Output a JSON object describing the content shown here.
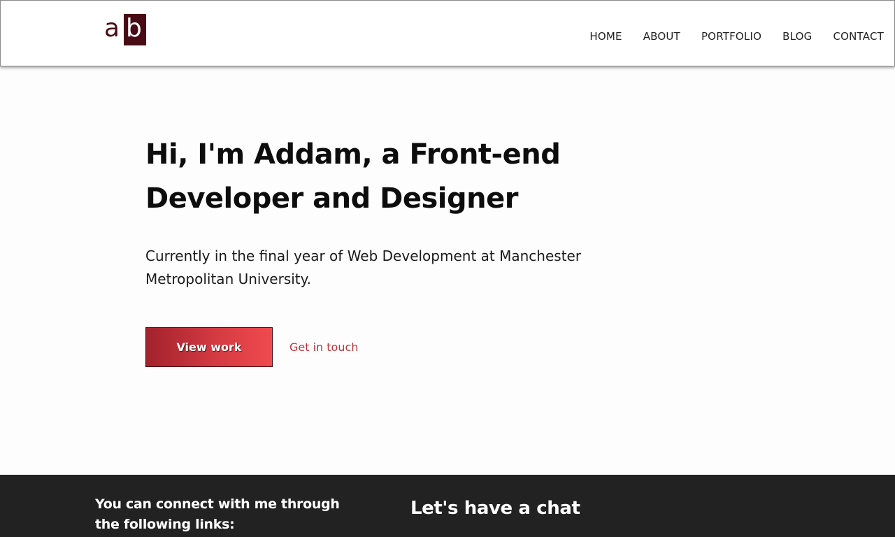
{
  "header": {
    "logo": {
      "letter_a": "a",
      "letter_b": "b"
    },
    "nav": [
      "HOME",
      "ABOUT",
      "PORTFOLIO",
      "BLOG",
      "CONTACT"
    ]
  },
  "hero": {
    "heading_line1": "Hi, I'm Addam, a Front-end",
    "heading_line2": "Developer and Designer",
    "description": "Currently in the final year of Web Development at Manchester Metropolitan University.",
    "primary_button": "View work",
    "secondary_link": "Get in touch"
  },
  "footer": {
    "connect_text": "You can connect with me through the following links:",
    "chat_heading": "Let's have a chat"
  },
  "colors": {
    "brand": "#4a0c14",
    "accent": "#c0343a",
    "footer_bg": "#222222"
  }
}
